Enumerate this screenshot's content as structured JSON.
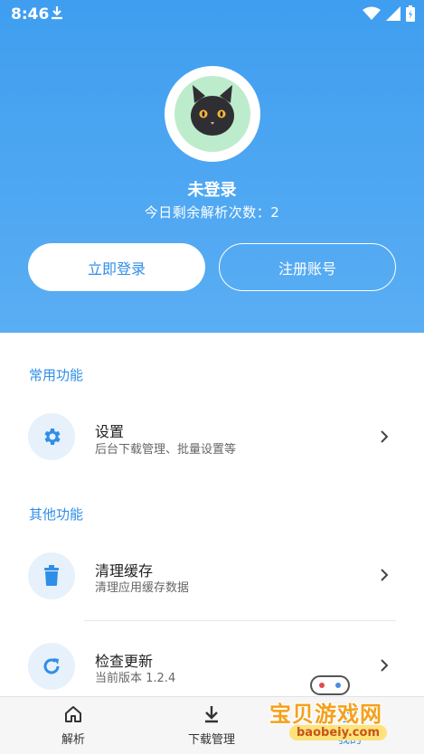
{
  "status": {
    "time": "8:46"
  },
  "profile": {
    "name": "未登录",
    "quota": "今日剩余解析次数：2",
    "login_button": "立即登录",
    "register_button": "注册账号"
  },
  "sections": {
    "common_title": "常用功能",
    "other_title": "其他功能"
  },
  "items": {
    "settings": {
      "title": "设置",
      "subtitle": "后台下载管理、批量设置等"
    },
    "clear_cache": {
      "title": "清理缓存",
      "subtitle": "清理应用缓存数据"
    },
    "check_update": {
      "title": "检查更新",
      "subtitle": "当前版本 1.2.4"
    }
  },
  "nav": {
    "parse": "解析",
    "downloads": "下载管理",
    "mine": "我的"
  },
  "watermark": {
    "text": "宝贝游戏网",
    "url": "baobeiy.com"
  },
  "colors": {
    "accent": "#2f8ee8",
    "header": "#4aa5f1",
    "icon_bg": "#e7f1fb"
  }
}
